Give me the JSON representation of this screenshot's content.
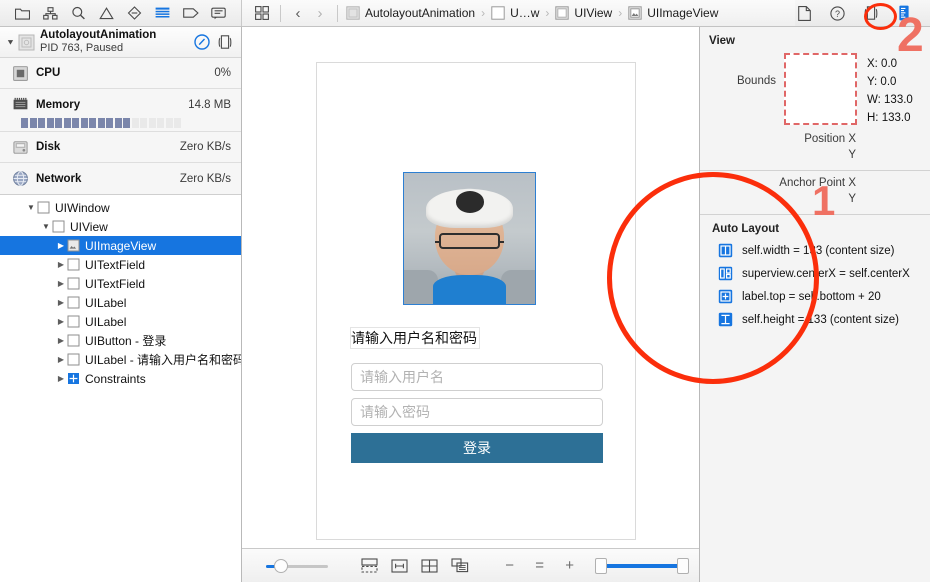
{
  "navigator_tabs": [
    {
      "name": "project-navigator",
      "icon": "folder-icon"
    },
    {
      "name": "source-control-navigator",
      "icon": "hierarchy-icon"
    },
    {
      "name": "find-navigator",
      "icon": "search-icon"
    },
    {
      "name": "issue-navigator",
      "icon": "warning-icon"
    },
    {
      "name": "test-navigator",
      "icon": "diamond-icon"
    },
    {
      "name": "debug-navigator",
      "icon": "debug-icon"
    },
    {
      "name": "breakpoint-navigator",
      "icon": "tag-icon"
    },
    {
      "name": "report-navigator",
      "icon": "message-icon"
    }
  ],
  "jumpbar": {
    "back_label": "‹",
    "forward_label": "›",
    "crumbs": [
      {
        "label": "AutolayoutAnimation",
        "icon": "project-icon"
      },
      {
        "label": "U…w",
        "icon": "view-icon"
      },
      {
        "label": "UIView",
        "icon": "view-icon"
      },
      {
        "label": "UIImageView",
        "icon": "imageview-icon"
      }
    ]
  },
  "inspector_tabs": [
    {
      "name": "file-inspector",
      "icon": "file-icon",
      "active": false
    },
    {
      "name": "quick-help-inspector",
      "icon": "help-icon",
      "active": false
    },
    {
      "name": "object-inspector",
      "icon": "object-icon",
      "active": false
    },
    {
      "name": "size-inspector",
      "icon": "ruler-icon",
      "active": true
    }
  ],
  "process": {
    "name": "AutolayoutAnimation",
    "status": "PID 763, Paused",
    "disclosure": "▼"
  },
  "gauges": [
    {
      "label": "CPU",
      "value": "0%",
      "icon": "cpu-icon"
    },
    {
      "label": "Memory",
      "value": "14.8 MB",
      "icon": "memory-icon"
    },
    {
      "label": "Disk",
      "value": "Zero KB/s",
      "icon": "disk-icon"
    },
    {
      "label": "Network",
      "value": "Zero KB/s",
      "icon": "network-icon"
    }
  ],
  "memory_bar": {
    "segments": 19,
    "filled": 13
  },
  "tree": [
    {
      "label": "UIWindow",
      "indent": 1,
      "tri": "open",
      "icon": "view-icon",
      "selected": false
    },
    {
      "label": "UIView",
      "indent": 2,
      "tri": "open",
      "icon": "view-icon",
      "selected": false
    },
    {
      "label": "UIImageView",
      "indent": 3,
      "tri": "closed",
      "icon": "imageview-icon",
      "selected": true
    },
    {
      "label": "UITextField",
      "indent": 3,
      "tri": "closed",
      "icon": "view-icon",
      "selected": false
    },
    {
      "label": "UITextField",
      "indent": 3,
      "tri": "closed",
      "icon": "view-icon",
      "selected": false
    },
    {
      "label": "UILabel",
      "indent": 3,
      "tri": "closed",
      "icon": "view-icon",
      "selected": false
    },
    {
      "label": "UILabel",
      "indent": 3,
      "tri": "closed",
      "icon": "view-icon",
      "selected": false
    },
    {
      "label": "UIButton - 登录",
      "indent": 3,
      "tri": "closed",
      "icon": "view-icon",
      "selected": false
    },
    {
      "label": "UILabel - 请输入用户名和密码",
      "indent": 3,
      "tri": "closed",
      "icon": "view-icon",
      "selected": false
    },
    {
      "label": "Constraints",
      "indent": 3,
      "tri": "closed",
      "icon": "constraint-icon",
      "selected": false
    }
  ],
  "canvas": {
    "label_text": "请输入用户名和密码",
    "username_placeholder": "请输入用户名",
    "password_placeholder": "请输入密码",
    "login_button": "登录",
    "button_color": "#2d7096"
  },
  "annotations": [
    {
      "label": "1",
      "color": "#ef7163"
    },
    {
      "label": "2",
      "color": "#ef7163"
    }
  ],
  "annotation_ring_color": "#fb2e0b",
  "bottom_bar": {
    "depth_percent": 25,
    "zoom_out": "−",
    "zoom_reset": "=",
    "zoom_in": "+",
    "icons": [
      {
        "name": "show-clipped-content-icon"
      },
      {
        "name": "show-constraints-icon"
      },
      {
        "name": "orthographic-view-icon"
      },
      {
        "name": "double-sided-icon"
      }
    ]
  },
  "inspector": {
    "section_title": "View",
    "bounds_label": "Bounds",
    "bounds": [
      {
        "key": "X:",
        "value": "0.0"
      },
      {
        "key": "Y:",
        "value": "0.0"
      },
      {
        "key": "W:",
        "value": "133.0"
      },
      {
        "key": "H:",
        "value": "133.0"
      }
    ],
    "position_x_label": "Position X",
    "position_y_label": "Y",
    "anchor_x_label": "Anchor Point X",
    "anchor_y_label": "Y",
    "autolayout_title": "Auto Layout",
    "constraints": [
      {
        "text": "self.width = 133 (content size)",
        "icon": "width-constraint-icon"
      },
      {
        "text": "superview.centerX = self.centerX",
        "icon": "centerx-constraint-icon"
      },
      {
        "text": "label.top = self.bottom + 20",
        "icon": "spacing-constraint-icon"
      },
      {
        "text": "self.height = 133 (content size)",
        "icon": "height-constraint-icon"
      }
    ]
  }
}
